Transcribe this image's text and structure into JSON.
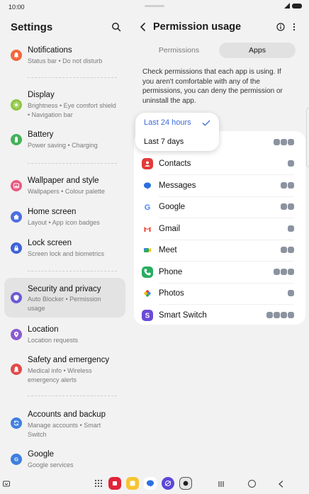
{
  "status_bar": {
    "time": "10:00"
  },
  "settings": {
    "title": "Settings",
    "items": [
      {
        "title": "Notifications",
        "subtitle": "Status bar  •  Do not disturb",
        "icon": "bell-icon",
        "color": "#f2683c"
      },
      {
        "title": "Display",
        "subtitle": "Brightness  •  Eye comfort shield  •  Navigation bar",
        "icon": "sun-icon",
        "color": "#8ec63f"
      },
      {
        "title": "Battery",
        "subtitle": "Power saving  •  Charging",
        "icon": "battery-icon",
        "color": "#45b25a"
      },
      {
        "title": "Wallpaper and style",
        "subtitle": "Wallpapers  •  Colour palette",
        "icon": "image-icon",
        "color": "#e85b82"
      },
      {
        "title": "Home screen",
        "subtitle": "Layout  •  App icon badges",
        "icon": "home-icon",
        "color": "#4c6fe0"
      },
      {
        "title": "Lock screen",
        "subtitle": "Screen lock and biometrics",
        "icon": "lock-icon",
        "color": "#3f63d8"
      },
      {
        "title": "Security and privacy",
        "subtitle": "Auto Blocker  •  Permission usage",
        "icon": "shield-icon",
        "color": "#6b5bd6"
      },
      {
        "title": "Location",
        "subtitle": "Location requests",
        "icon": "location-pin-icon",
        "color": "#8b5bd0"
      },
      {
        "title": "Safety and emergency",
        "subtitle": "Medical info  •  Wireless emergency alerts",
        "icon": "emergency-bell-icon",
        "color": "#e24a4a"
      },
      {
        "title": "Accounts and backup",
        "subtitle": "Manage accounts  •  Smart Switch",
        "icon": "sync-icon",
        "color": "#3f7fe0"
      },
      {
        "title": "Google",
        "subtitle": "Google services",
        "icon": "google-g-icon",
        "color": "#3f7fe0"
      }
    ]
  },
  "permission_usage": {
    "title": "Permission usage",
    "tabs": [
      {
        "label": "Permissions",
        "selected": false
      },
      {
        "label": "Apps",
        "selected": true
      }
    ],
    "description": "Check permissions that each app is using. If you aren't comfortable with any of the permissions, you can deny the permission or uninstall the app.",
    "range_dropdown": {
      "options": [
        "Last 24 hours",
        "Last 7 days"
      ],
      "selected": "Last 24 hours",
      "accent": "#3c6bd7"
    },
    "apps": [
      {
        "name": "Contacts",
        "icon": "contacts-icon",
        "color": "#e23a3a",
        "permission_icons": 1
      },
      {
        "name": "Messages",
        "icon": "messages-icon",
        "color": "#2a6fe0",
        "permission_icons": 2
      },
      {
        "name": "Google",
        "icon": "google-g-icon",
        "color": "#ffffff",
        "permission_icons": 2
      },
      {
        "name": "Gmail",
        "icon": "gmail-icon",
        "color": "#ffffff",
        "permission_icons": 1
      },
      {
        "name": "Meet",
        "icon": "meet-icon",
        "color": "#ffffff",
        "permission_icons": 2
      },
      {
        "name": "Phone",
        "icon": "phone-icon",
        "color": "#27ae60",
        "permission_icons": 3
      },
      {
        "name": "Photos",
        "icon": "photos-icon",
        "color": "#ffffff",
        "permission_icons": 1
      },
      {
        "name": "Smart Switch",
        "icon": "smart-switch-icon",
        "color": "#6a4bd8",
        "permission_icons": 4
      }
    ],
    "hidden_row_permission_icons": 3
  },
  "dock": {
    "apps": [
      "apps-grid-icon",
      "flipboard-icon",
      "notes-icon",
      "messages-icon",
      "internet-icon",
      "camera-icon"
    ]
  }
}
